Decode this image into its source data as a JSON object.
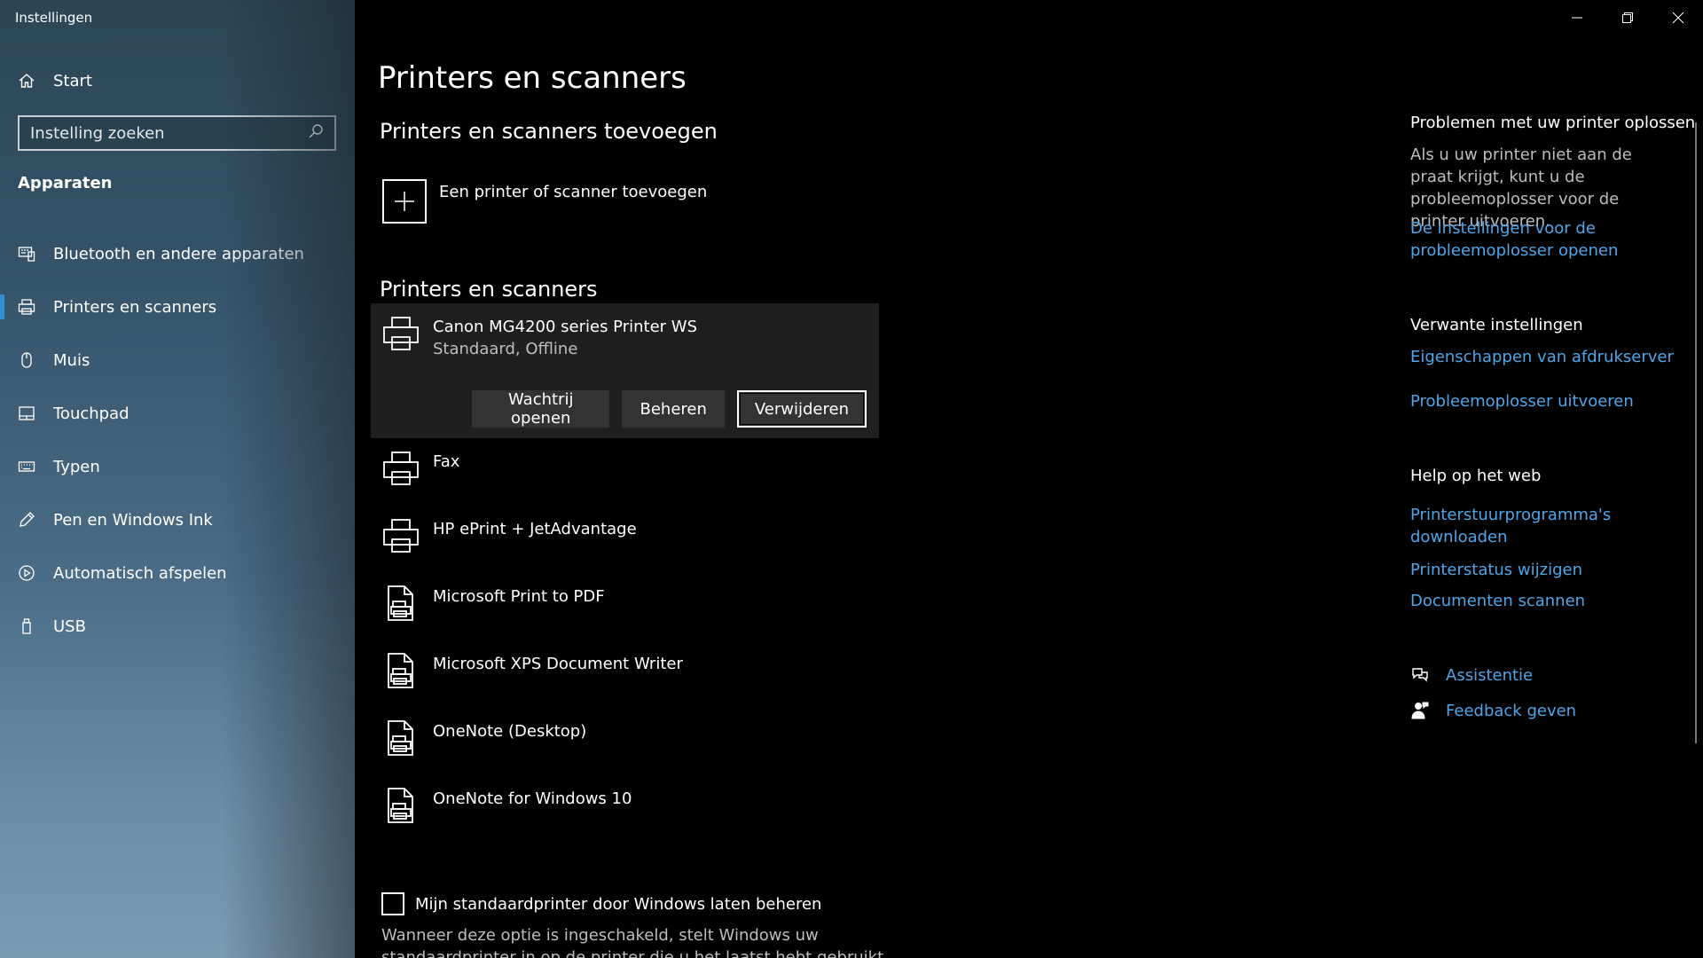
{
  "window": {
    "title": "Instellingen"
  },
  "sidebar": {
    "home_label": "Start",
    "search_placeholder": "Instelling zoeken",
    "section_label": "Apparaten",
    "items": [
      {
        "label": "Bluetooth en andere apparaten",
        "icon": "bluetooth-devices-icon",
        "selected": false
      },
      {
        "label": "Printers en scanners",
        "icon": "printer-icon",
        "selected": true
      },
      {
        "label": "Muis",
        "icon": "mouse-icon",
        "selected": false
      },
      {
        "label": "Touchpad",
        "icon": "touchpad-icon",
        "selected": false
      },
      {
        "label": "Typen",
        "icon": "keyboard-icon",
        "selected": false
      },
      {
        "label": "Pen en Windows Ink",
        "icon": "pen-icon",
        "selected": false
      },
      {
        "label": "Automatisch afspelen",
        "icon": "autoplay-icon",
        "selected": false
      },
      {
        "label": "USB",
        "icon": "usb-icon",
        "selected": false
      }
    ],
    "accent_color": "#2f8fd6"
  },
  "main": {
    "page_title": "Printers en scanners",
    "add_section_title": "Printers en scanners toevoegen",
    "add_label": "Een printer of scanner toevoegen",
    "list_title": "Printers en scanners",
    "printers": [
      {
        "name": "Canon MG4200 series Printer WS",
        "status": "Standaard, Offline",
        "icon": "printer-icon",
        "selected": true
      },
      {
        "name": "Fax",
        "status": "",
        "icon": "printer-icon",
        "selected": false
      },
      {
        "name": "HP ePrint + JetAdvantage",
        "status": "",
        "icon": "printer-icon",
        "selected": false
      },
      {
        "name": "Microsoft Print to PDF",
        "status": "",
        "icon": "document-printer-icon",
        "selected": false
      },
      {
        "name": "Microsoft XPS Document Writer",
        "status": "",
        "icon": "document-printer-icon",
        "selected": false
      },
      {
        "name": "OneNote (Desktop)",
        "status": "",
        "icon": "document-printer-icon",
        "selected": false
      },
      {
        "name": "OneNote for Windows 10",
        "status": "",
        "icon": "document-printer-icon",
        "selected": false
      }
    ],
    "buttons": {
      "queue": "Wachtrij openen",
      "manage": "Beheren",
      "remove": "Verwijderen"
    },
    "checkbox_label": "Mijn standaardprinter door Windows laten beheren",
    "checkbox_checked": false,
    "checkbox_description": "Wanneer deze optie is ingeschakeld, stelt Windows uw standaardprinter in op de printer die u het laatst hebt gebruikt op"
  },
  "right_panel": {
    "troubleshoot_heading": "Problemen met uw printer oplossen",
    "troubleshoot_text": "Als u uw printer niet aan de praat krijgt, kunt u de probleemoplosser voor de printer uitvoeren.",
    "troubleshoot_link": "De instellingen voor de probleemoplosser openen",
    "related_heading": "Verwante instellingen",
    "related_links": [
      "Eigenschappen van afdrukserver",
      "Probleemoplosser uitvoeren"
    ],
    "help_heading": "Help op het web",
    "help_links": [
      "Printerstuurprogramma's downloaden",
      "Printerstatus wijzigen",
      "Documenten scannen"
    ],
    "assist_label": "Assistentie",
    "feedback_label": "Feedback geven",
    "link_color": "#4ea6e8"
  }
}
